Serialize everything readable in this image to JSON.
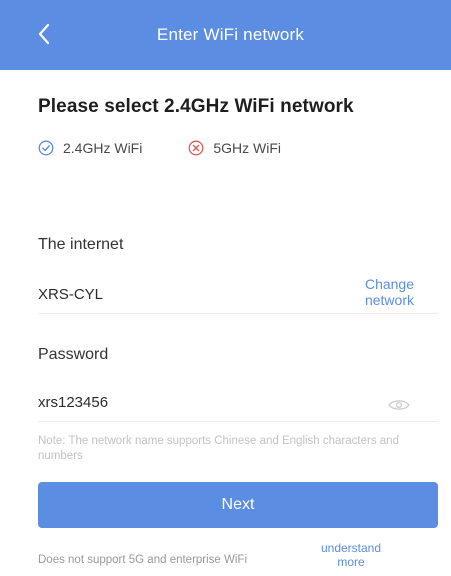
{
  "header": {
    "title": "Enter WiFi network",
    "back_icon": "chevron-left-icon",
    "color": "#5b8de3"
  },
  "heading": "Please select 2.4GHz WiFi network",
  "bands": [
    {
      "label": "2.4GHz WiFi",
      "icon": "check-circle-icon",
      "status": "supported",
      "color": "#5b8de3"
    },
    {
      "label": "5GHz WiFi",
      "icon": "x-circle-icon",
      "status": "unsupported",
      "color": "#e05a5a"
    }
  ],
  "network": {
    "label": "The internet",
    "value": "XRS-CYL",
    "change_link": "Change network"
  },
  "password": {
    "label": "Password",
    "value": "xrs123456",
    "visibility_icon": "eye-icon"
  },
  "note": "Note: The network name supports Chinese and English characters and numbers",
  "next_button": {
    "label": "Next"
  },
  "footer": {
    "text": "Does not support 5G and enterprise WiFi",
    "link": "understand more"
  }
}
